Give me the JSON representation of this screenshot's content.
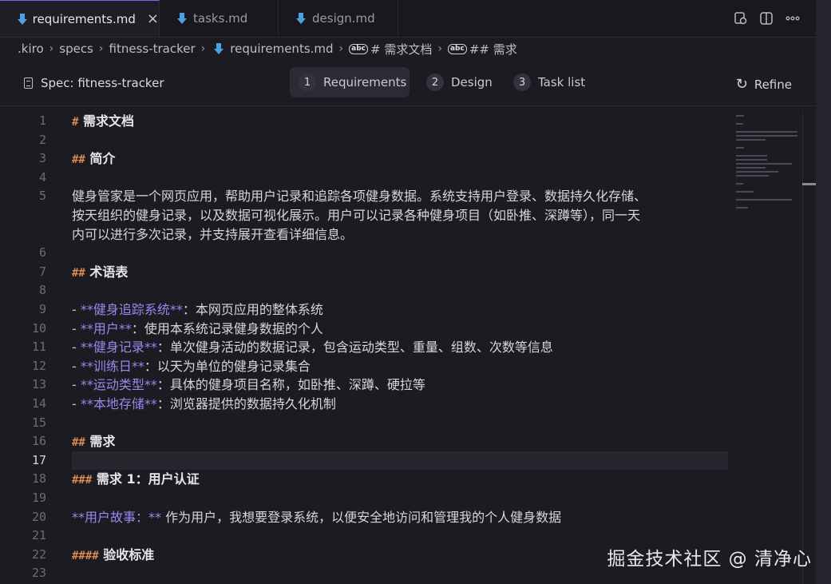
{
  "tabs": [
    {
      "label": "requirements.md",
      "active": true
    },
    {
      "label": "tasks.md",
      "active": false
    },
    {
      "label": "design.md",
      "active": false
    }
  ],
  "breadcrumb": {
    "items": [
      ".kiro",
      "specs",
      "fitness-tracker",
      "requirements.md",
      "# 需求文档",
      "## 需求"
    ]
  },
  "spec": {
    "title": "Spec: fitness-tracker",
    "steps": [
      {
        "num": "1",
        "label": "Requirements"
      },
      {
        "num": "2",
        "label": "Design"
      },
      {
        "num": "3",
        "label": "Task list"
      }
    ],
    "refine_label": "Refine"
  },
  "editor": {
    "current_line": 17,
    "lines": [
      {
        "n": "1",
        "parts": [
          {
            "t": "#",
            "c": "hash"
          },
          {
            "t": " 需求文档",
            "c": "head"
          }
        ]
      },
      {
        "n": "2",
        "parts": []
      },
      {
        "n": "3",
        "parts": [
          {
            "t": "##",
            "c": "hash"
          },
          {
            "t": " 简介",
            "c": "head"
          }
        ]
      },
      {
        "n": "4",
        "parts": []
      },
      {
        "n": "5",
        "parts": [
          {
            "t": "健身管家是一个网页应用，帮助用户记录和追踪各项健身数据。系统支持用户登录、数据持久化存储、",
            "c": "plain"
          }
        ]
      },
      {
        "n": "",
        "parts": [
          {
            "t": "按天组织的健身记录，以及数据可视化展示。用户可以记录各种健身项目（如卧推、深蹲等），同一天",
            "c": "plain"
          }
        ]
      },
      {
        "n": "",
        "parts": [
          {
            "t": "内可以进行多次记录，并支持展开查看详细信息。",
            "c": "plain"
          }
        ]
      },
      {
        "n": "6",
        "parts": []
      },
      {
        "n": "7",
        "parts": [
          {
            "t": "##",
            "c": "hash"
          },
          {
            "t": " 术语表",
            "c": "head"
          }
        ]
      },
      {
        "n": "8",
        "parts": []
      },
      {
        "n": "9",
        "parts": [
          {
            "t": "- ",
            "c": "dash"
          },
          {
            "t": "**健身追踪系统**",
            "c": "em"
          },
          {
            "t": "：本网页应用的整体系统",
            "c": "plain"
          }
        ]
      },
      {
        "n": "10",
        "parts": [
          {
            "t": "- ",
            "c": "dash"
          },
          {
            "t": "**用户**",
            "c": "em"
          },
          {
            "t": "：使用本系统记录健身数据的个人",
            "c": "plain"
          }
        ]
      },
      {
        "n": "11",
        "parts": [
          {
            "t": "- ",
            "c": "dash"
          },
          {
            "t": "**健身记录**",
            "c": "em"
          },
          {
            "t": "：单次健身活动的数据记录，包含运动类型、重量、组数、次数等信息",
            "c": "plain"
          }
        ]
      },
      {
        "n": "12",
        "parts": [
          {
            "t": "- ",
            "c": "dash"
          },
          {
            "t": "**训练日**",
            "c": "em"
          },
          {
            "t": "：以天为单位的健身记录集合",
            "c": "plain"
          }
        ]
      },
      {
        "n": "13",
        "parts": [
          {
            "t": "- ",
            "c": "dash"
          },
          {
            "t": "**运动类型**",
            "c": "em"
          },
          {
            "t": "：具体的健身项目名称，如卧推、深蹲、硬拉等",
            "c": "plain"
          }
        ]
      },
      {
        "n": "14",
        "parts": [
          {
            "t": "- ",
            "c": "dash"
          },
          {
            "t": "**本地存储**",
            "c": "em"
          },
          {
            "t": "：浏览器提供的数据持久化机制",
            "c": "plain"
          }
        ]
      },
      {
        "n": "15",
        "parts": []
      },
      {
        "n": "16",
        "parts": [
          {
            "t": "##",
            "c": "hash"
          },
          {
            "t": " 需求",
            "c": "head"
          }
        ]
      },
      {
        "n": "17",
        "parts": []
      },
      {
        "n": "18",
        "parts": [
          {
            "t": "###",
            "c": "hash"
          },
          {
            "t": " 需求 1：用户认证",
            "c": "head"
          }
        ]
      },
      {
        "n": "19",
        "parts": []
      },
      {
        "n": "20",
        "parts": [
          {
            "t": "**用户故事：**",
            "c": "em"
          },
          {
            "t": " 作为用户，我想要登录系统，以便安全地访问和管理我的个人健身数据",
            "c": "plain"
          }
        ]
      },
      {
        "n": "21",
        "parts": []
      },
      {
        "n": "22",
        "parts": [
          {
            "t": "####",
            "c": "hash"
          },
          {
            "t": " 验收标准",
            "c": "head"
          }
        ]
      },
      {
        "n": "23",
        "parts": []
      }
    ]
  },
  "watermark": "掘金技术社区 @ 清净心",
  "colors": {
    "accent": "#6f6fe0",
    "heading_marker": "#d98b52",
    "emphasis": "#9d86ec",
    "background": "#1c1b22"
  }
}
